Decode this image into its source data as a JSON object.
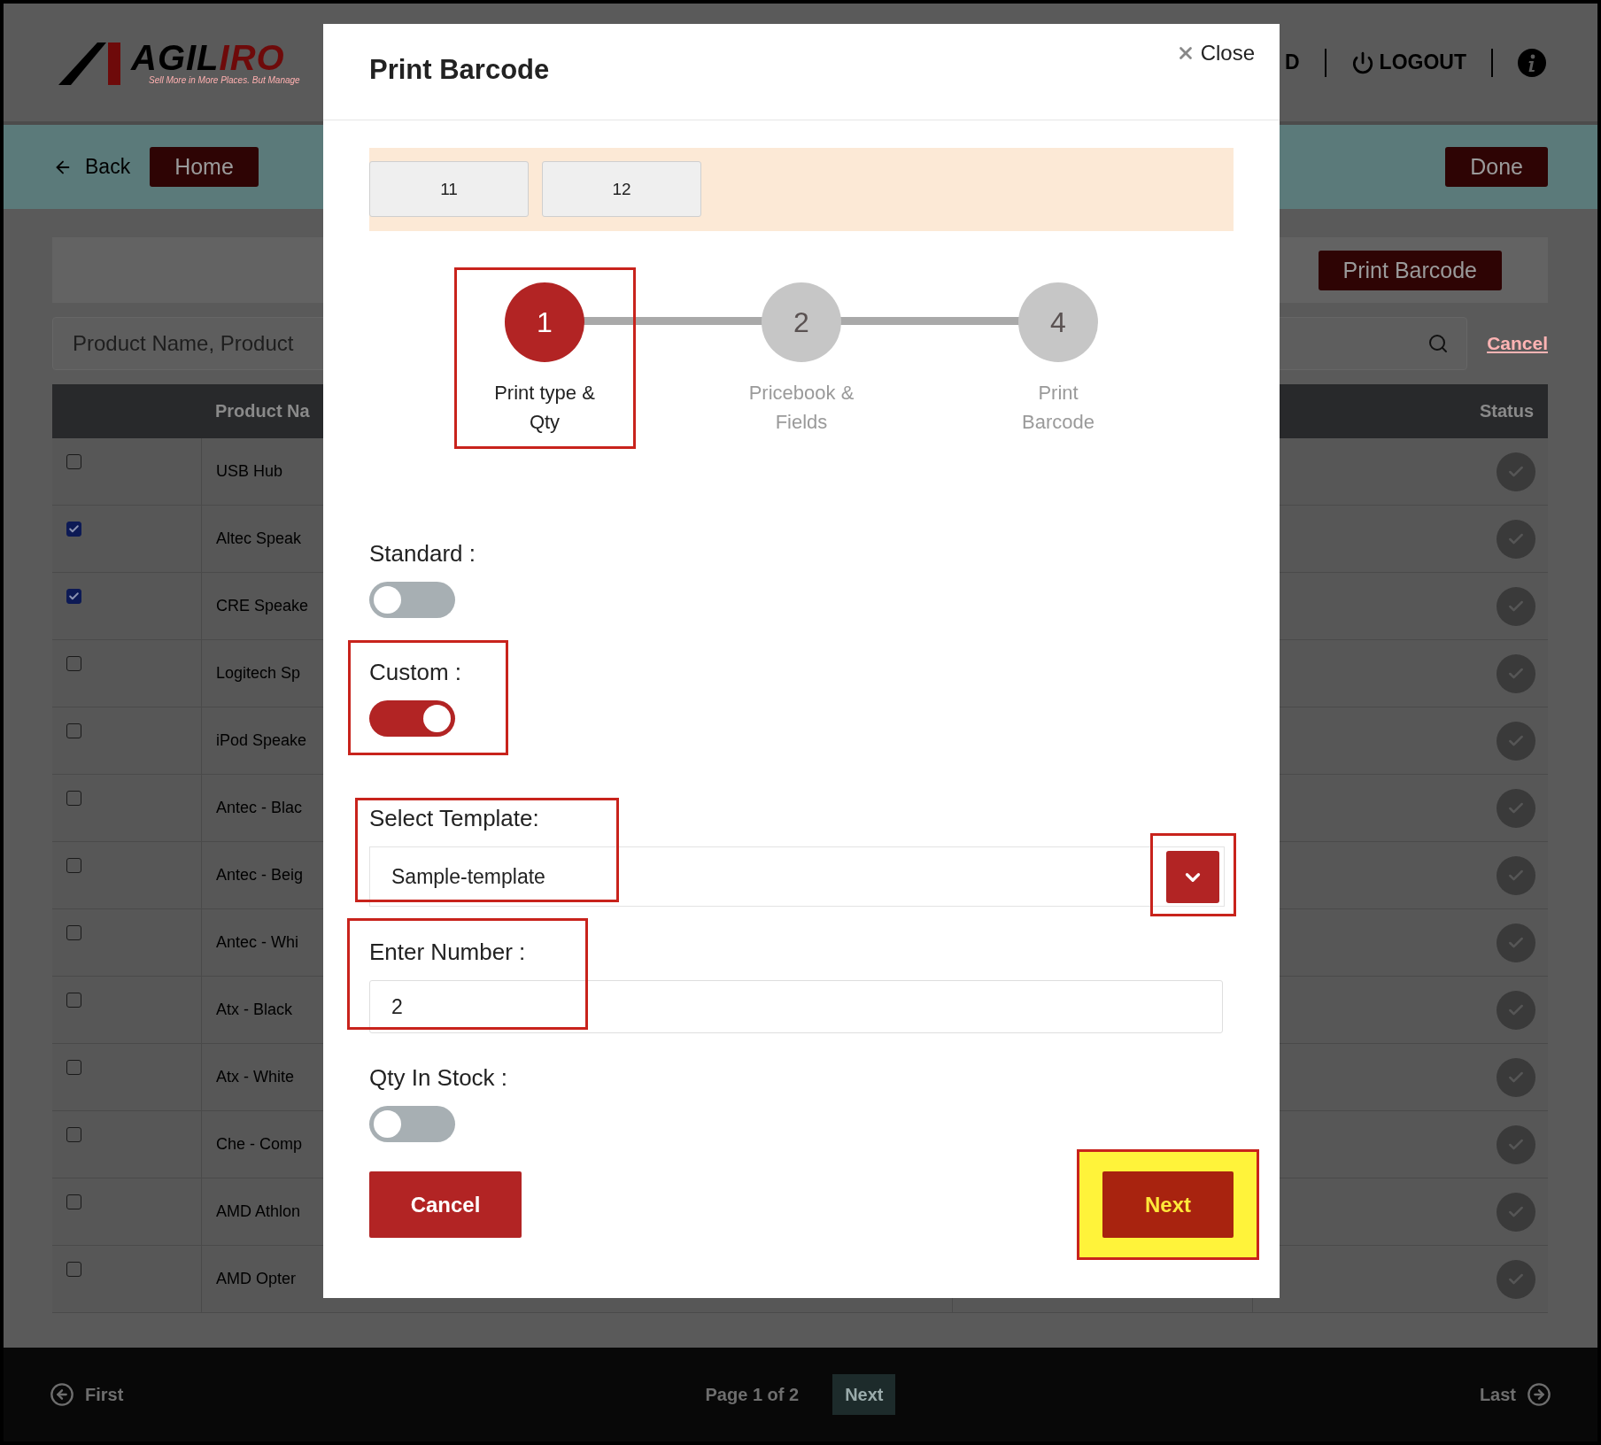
{
  "header": {
    "logo": {
      "dark": "AGIL",
      "accent": "IRO",
      "tagline": "Sell More in More Places. But Manage"
    },
    "nav_partial": "D",
    "logout": "LOGOUT"
  },
  "toolbar": {
    "back": "Back",
    "home": "Home",
    "done": "Done"
  },
  "actions": {
    "print_barcode": "Print Barcode"
  },
  "search": {
    "placeholder": "Product Name, Product",
    "cancel": "Cancel"
  },
  "table": {
    "columns": [
      "Product Na",
      "Status"
    ],
    "rows": [
      {
        "checked": false,
        "name": "USB Hub"
      },
      {
        "checked": true,
        "name": "Altec Speak"
      },
      {
        "checked": true,
        "name": "CRE Speake"
      },
      {
        "checked": false,
        "name": "Logitech Sp"
      },
      {
        "checked": false,
        "name": "iPod Speake"
      },
      {
        "checked": false,
        "name": "Antec - Blac"
      },
      {
        "checked": false,
        "name": "Antec - Beig"
      },
      {
        "checked": false,
        "name": "Antec - Whi"
      },
      {
        "checked": false,
        "name": "Atx - Black"
      },
      {
        "checked": false,
        "name": "Atx - White"
      },
      {
        "checked": false,
        "name": "Che - Comp"
      },
      {
        "checked": false,
        "name": "AMD Athlon"
      },
      {
        "checked": false,
        "name": "AMD Opter"
      }
    ]
  },
  "footer": {
    "first": "First",
    "page": "Page 1 of 2",
    "next": "Next",
    "last": "Last"
  },
  "modal": {
    "title": "Print Barcode",
    "close": "Close",
    "chips": [
      "11",
      "12"
    ],
    "steps": [
      {
        "number": "1",
        "label": "Print type & Qty",
        "selected": true,
        "highlighted": true
      },
      {
        "number": "2",
        "label": "Pricebook & Fields",
        "selected": false,
        "highlighted": false
      },
      {
        "number": "4",
        "label": "Print Barcode",
        "selected": false,
        "highlighted": false
      }
    ],
    "fields": [
      {
        "kind": "toggle",
        "label": "Standard :",
        "on": false,
        "highlighted": false
      },
      {
        "kind": "toggle",
        "label": "Custom :",
        "on": true,
        "highlighted": true
      },
      {
        "kind": "select",
        "label": "Select Template:",
        "value": "Sample-template",
        "highlighted": true,
        "button_highlighted": true
      },
      {
        "kind": "input",
        "label": "Enter Number :",
        "value": "2",
        "highlighted": true
      },
      {
        "kind": "toggle",
        "label": "Qty In Stock :",
        "on": false,
        "highlighted": false
      }
    ],
    "buttons": [
      {
        "kind": "cancel",
        "label": "Cancel",
        "highlighted": false
      },
      {
        "kind": "next",
        "label": "Next",
        "highlighted": true
      }
    ]
  }
}
